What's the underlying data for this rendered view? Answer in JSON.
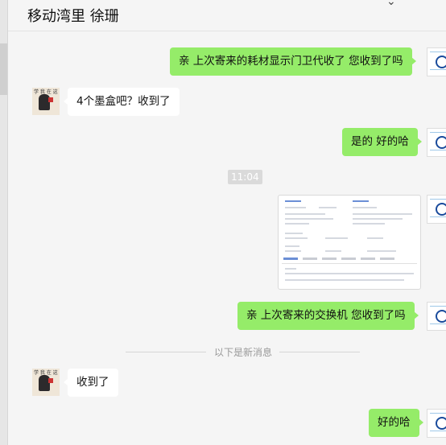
{
  "chat": {
    "title": "移动湾里 徐珊",
    "menu_icon": "ellipsis-icon"
  },
  "messages": {
    "m1": "亲 上次寄来的耗材显示门卫代收了 您收到了吗",
    "m2": "4个墨盒吧？收到了",
    "m3": "是的 好的哈",
    "time": "11:04",
    "m5": "亲 上次寄来的交换机 您收到了吗",
    "divider": "以下是新消息",
    "m6": "收到了",
    "m7": "好的哈"
  },
  "colors": {
    "sent_bubble": "#95ec69",
    "received_bubble": "#ffffff",
    "background": "#f5f5f5"
  }
}
